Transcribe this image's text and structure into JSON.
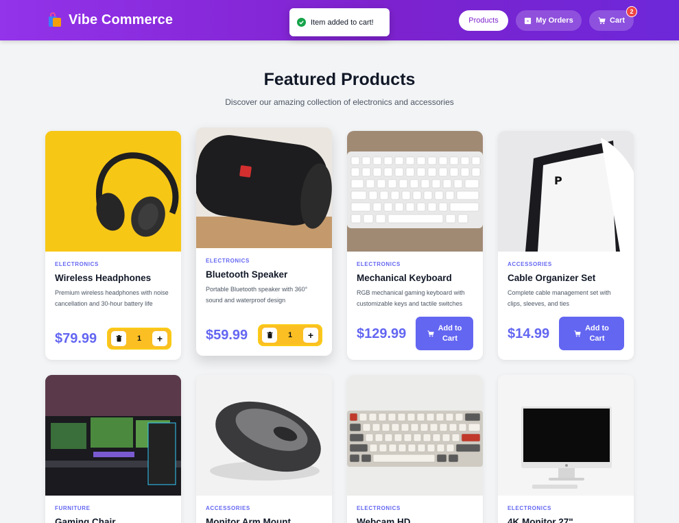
{
  "header": {
    "brand": "Vibe Commerce",
    "toast": "Item added to cart!",
    "nav": {
      "products": "Products",
      "orders": "My Orders",
      "cart": "Cart",
      "cart_count": "2"
    }
  },
  "hero": {
    "title": "Featured Products",
    "subtitle": "Discover our amazing collection of electronics and accessories"
  },
  "products": [
    {
      "category": "ELECTRONICS",
      "name": "Wireless Headphones",
      "description": "Premium wireless headphones with noise cancellation and 30-hour battery life",
      "price": "$79.99",
      "in_cart": true,
      "quantity": "1"
    },
    {
      "category": "ELECTRONICS",
      "name": "Bluetooth Speaker",
      "description": "Portable Bluetooth speaker with 360° sound and waterproof design",
      "price": "$59.99",
      "in_cart": true,
      "quantity": "1"
    },
    {
      "category": "ELECTRONICS",
      "name": "Mechanical Keyboard",
      "description": "RGB mechanical gaming keyboard with customizable keys and tactile switches",
      "price": "$129.99",
      "in_cart": false,
      "button_line1": "Add to",
      "button_line2": "Cart"
    },
    {
      "category": "ACCESSORIES",
      "name": "Cable Organizer Set",
      "description": "Complete cable management set with clips, sleeves, and ties",
      "price": "$14.99",
      "in_cart": false,
      "button_line1": "Add to",
      "button_line2": "Cart"
    },
    {
      "category": "FURNITURE",
      "name": "Gaming Chair"
    },
    {
      "category": "ACCESSORIES",
      "name": "Monitor Arm Mount"
    },
    {
      "category": "ELECTRONICS",
      "name": "Webcam HD"
    },
    {
      "category": "ELECTRONICS",
      "name": "4K Monitor 27\""
    }
  ],
  "colors": {
    "accent": "#6366f1",
    "header_start": "#9333ea",
    "header_end": "#6d28d9",
    "qty_bg": "#fbbf24",
    "badge": "#ef4444"
  }
}
